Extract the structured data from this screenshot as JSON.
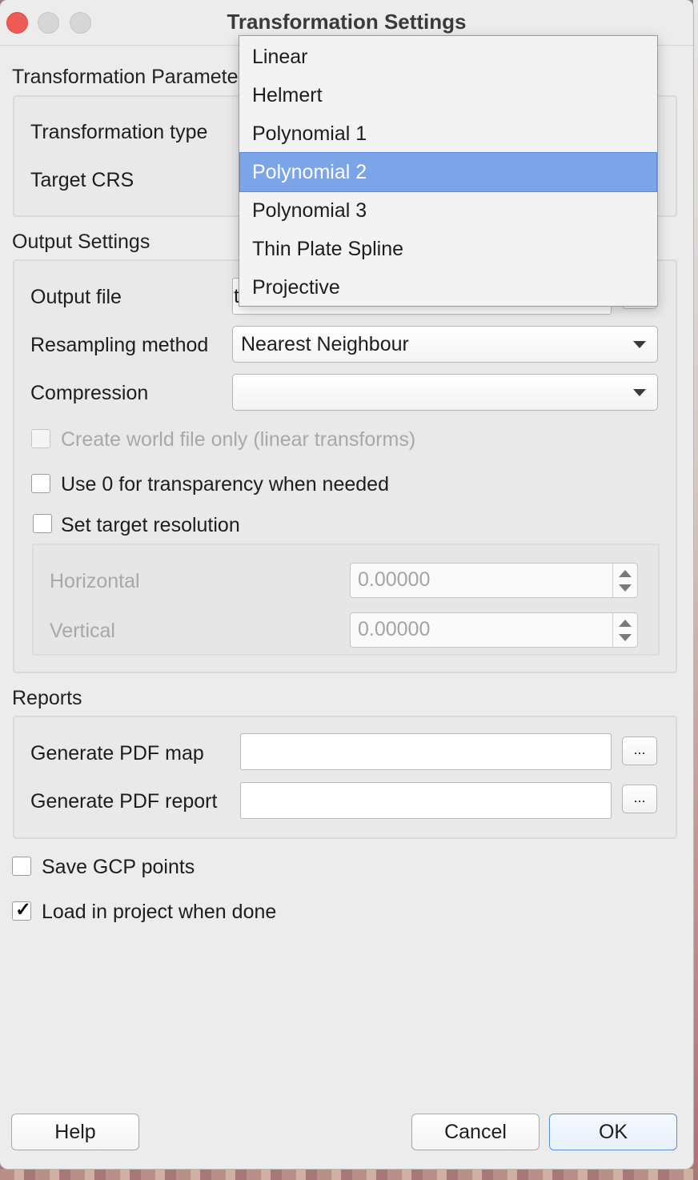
{
  "window": {
    "title": "Transformation Settings"
  },
  "params": {
    "section_title": "Transformation Parameters",
    "type_label": "Transformation type",
    "crs_label": "Target CRS"
  },
  "dropdown": {
    "options": [
      "Linear",
      "Helmert",
      "Polynomial 1",
      "Polynomial 2",
      "Polynomial 3",
      "Thin Plate Spline",
      "Projective"
    ],
    "selected": "Polynomial 2"
  },
  "output": {
    "section_title": "Output Settings",
    "file_label": "Output file",
    "file_value": "t",
    "resampling_label": "Resampling method",
    "resampling_value": "Nearest Neighbour",
    "compression_label": "Compression",
    "compression_value": "",
    "world_file_label": "Create world file only (linear transforms)",
    "transparency_label": "Use 0 for transparency when needed",
    "target_res_label": "Set target resolution",
    "horizontal_label": "Horizontal",
    "horizontal_value": "0.00000",
    "vertical_label": "Vertical",
    "vertical_value": "0.00000"
  },
  "reports": {
    "section_title": "Reports",
    "pdf_map_label": "Generate PDF map",
    "pdf_report_label": "Generate PDF report",
    "browse_label": "..."
  },
  "options": {
    "save_gcp_label": "Save GCP points",
    "save_gcp_checked": false,
    "load_project_label": "Load in project when done",
    "load_project_checked": true
  },
  "buttons": {
    "help": "Help",
    "cancel": "Cancel",
    "ok": "OK"
  },
  "colors": {
    "selection": "#7ba5e8",
    "close": "#ee5b55",
    "default_button_border": "#5a8ed8"
  }
}
